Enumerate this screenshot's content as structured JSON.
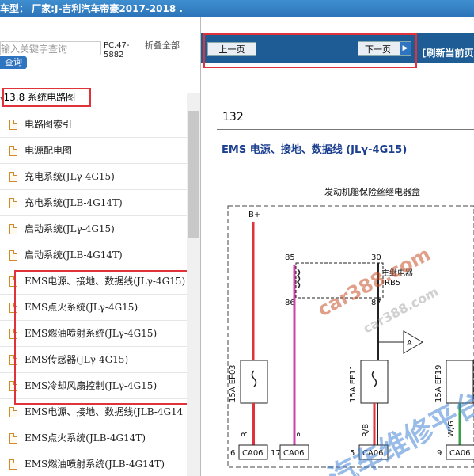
{
  "window": {
    "title": "车型： 厂家:J-吉利汽车帝豪2017-2018   ."
  },
  "sidebar": {
    "search_placeholder": "输入关键字查询",
    "search_button": "查询",
    "pc_code": "PC.47-5882",
    "collapse_all": "折叠全部",
    "root_node": "13.8 系统电路图",
    "items": [
      {
        "label": "电路图索引"
      },
      {
        "label": "电源配电图"
      },
      {
        "label": "充电系统(JLγ-4G15)"
      },
      {
        "label": "充电系统(JLB-4G14T)"
      },
      {
        "label": "启动系统(JLγ-4G15)"
      },
      {
        "label": "启动系统(JLB-4G14T)"
      },
      {
        "label": "EMS电源、接地、数据线(JLγ-4G15)"
      },
      {
        "label": "EMS点火系统(JLγ-4G15)"
      },
      {
        "label": "EMS燃油喷射系统(JLγ-4G15)"
      },
      {
        "label": "EMS传感器(JLγ-4G15)"
      },
      {
        "label": "EMS冷却风扇控制(JLγ-4G15)"
      },
      {
        "label": "EMS电源、接地、数据线(JLB-4G14"
      },
      {
        "label": "EMS点火系统(JLB-4G14T)"
      },
      {
        "label": "EMS燃油喷射系统(JLB-4G14T)"
      }
    ]
  },
  "toolbar": {
    "prev_label": "上一页",
    "next_label": "下一页",
    "refresh_label": "[刷新当前页"
  },
  "document": {
    "page_number": "132",
    "diagram_title": "EMS 电源、接地、数据线 (JLγ-4G15)",
    "box_title": "发动机舱保险丝继电器盒",
    "labels": {
      "b_plus": "B+",
      "pin85": "85",
      "pin30": "30",
      "pin86": "86",
      "pin87": "87",
      "relay_name": "主继电器",
      "relay_code": "RB5",
      "fuse1": "15A EF03",
      "fuse2": "15A EF11",
      "fuse3": "15A EF19",
      "node_a": "A",
      "wire1": "R",
      "wire2": "P",
      "wire3": "R/B",
      "wire4": "W/G",
      "conn1": "CA06",
      "conn2": "CA06",
      "conn3": "CA06",
      "conn4": "CA06",
      "pin6": "6",
      "pin17": "17",
      "pin5": "5",
      "pin9": "9"
    },
    "watermarks": [
      "car388.com",
      "car388.com",
      "汽车维修平台"
    ]
  }
}
